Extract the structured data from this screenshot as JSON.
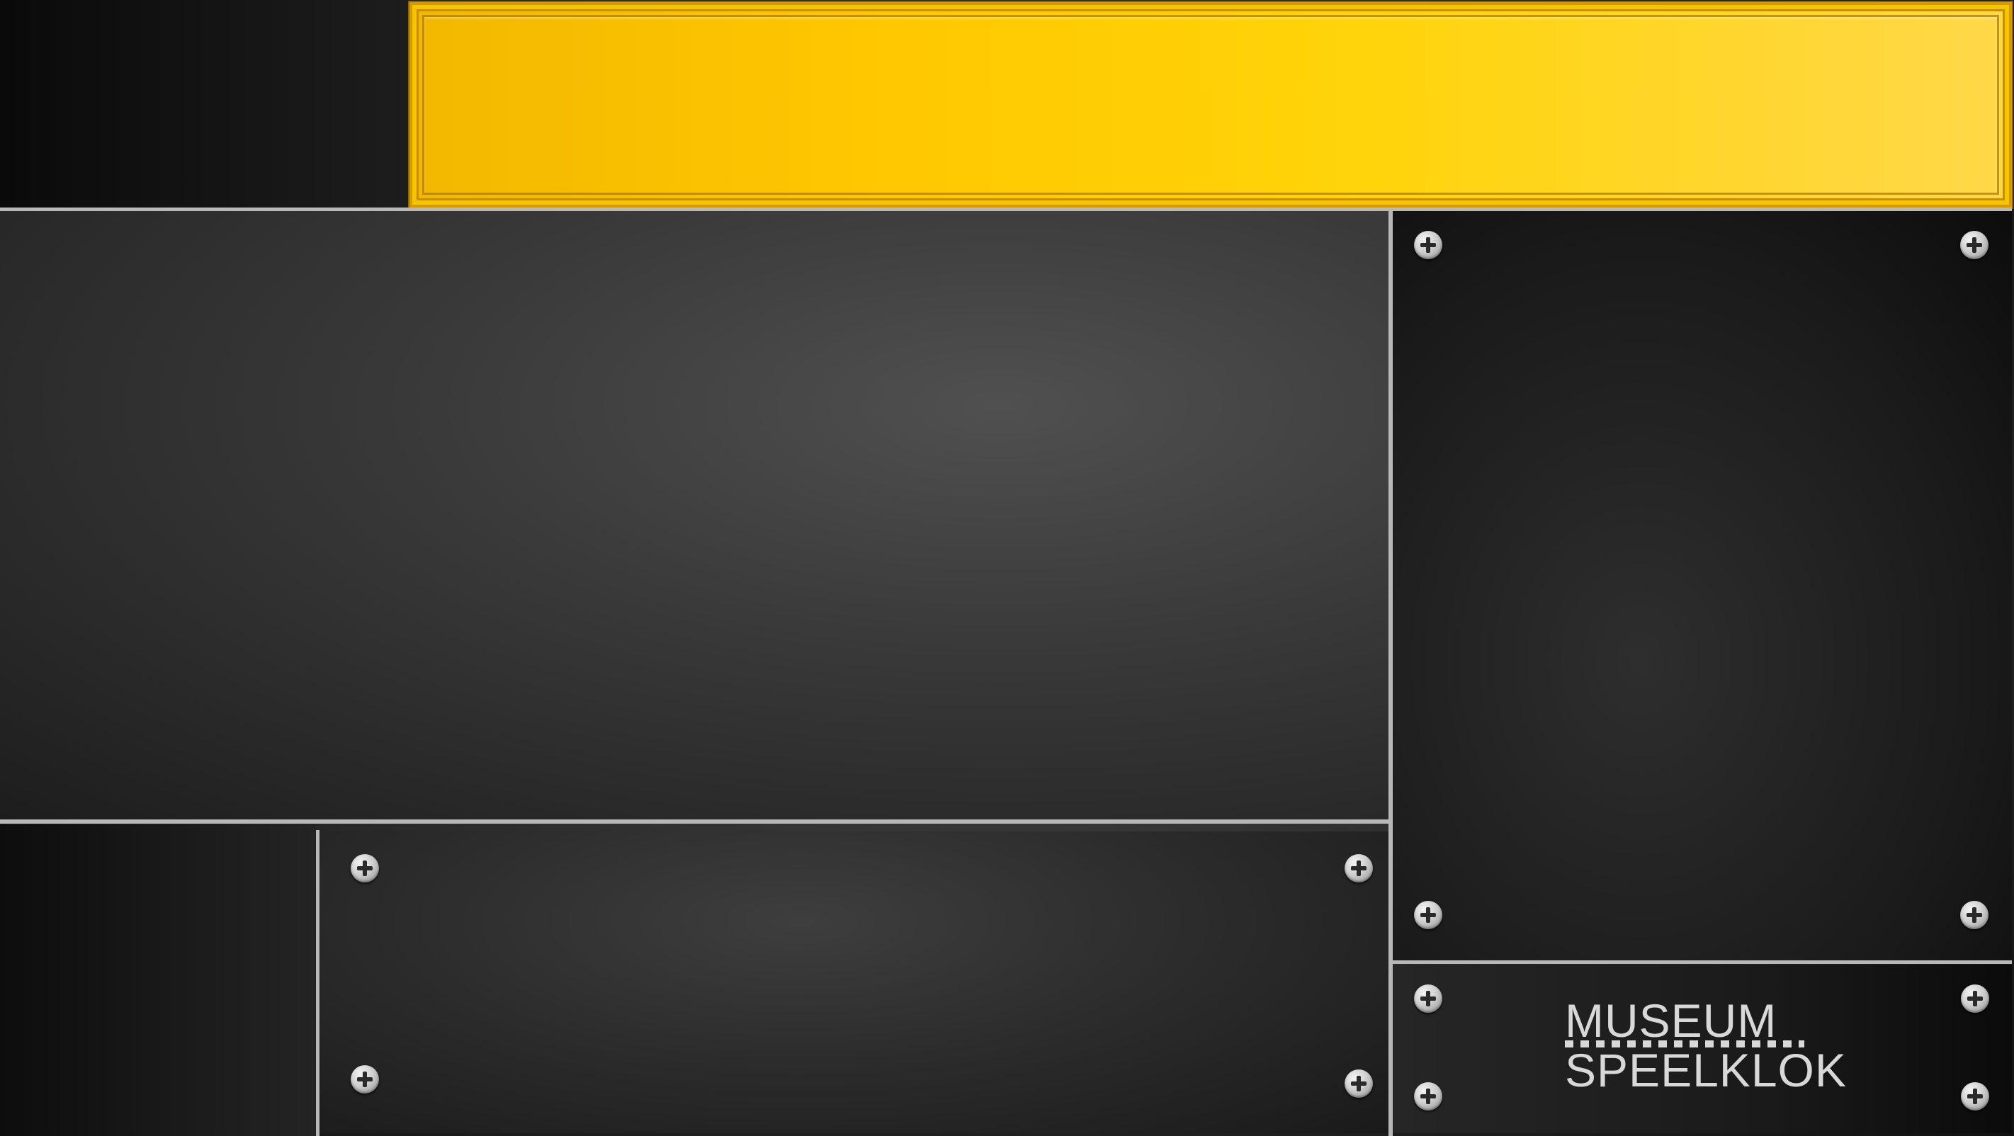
{
  "logo": {
    "line1": "MUSEUM",
    "line2": "SPEELKLOK",
    "color": "#d8d8d8"
  },
  "theme": {
    "banner_color": "#ffc800",
    "panel_color": "#2e2e2e",
    "divider_color": "#b8b8b8"
  },
  "icons": {
    "screw": "screw-icon"
  }
}
